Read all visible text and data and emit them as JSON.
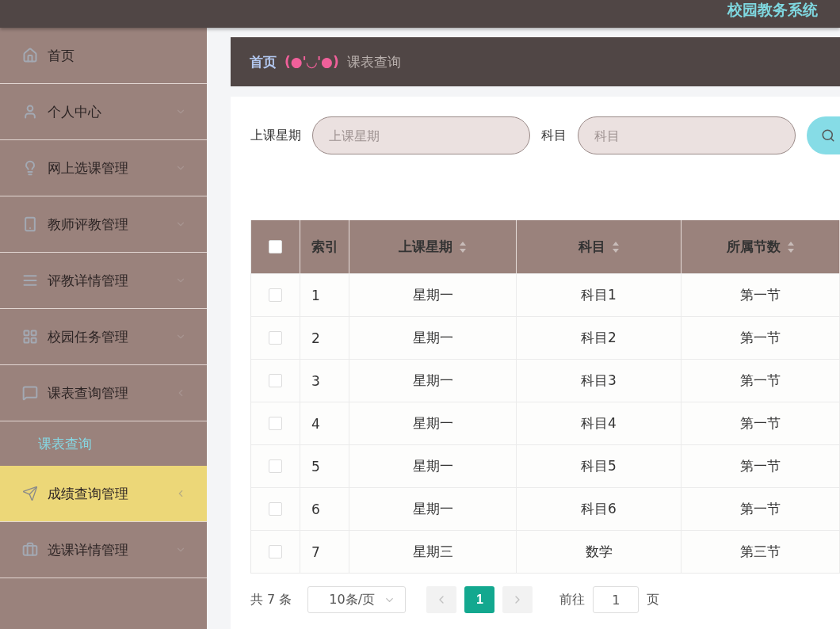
{
  "header": {
    "title": "校园教务系统"
  },
  "sidebar": {
    "items": [
      {
        "label": "首页",
        "selected": false,
        "has_arrow": false
      },
      {
        "label": "个人中心",
        "expanded": false,
        "selected": false,
        "has_arrow": true
      },
      {
        "label": "网上选课管理",
        "expanded": false,
        "selected": false,
        "has_arrow": true
      },
      {
        "label": "教师评教管理",
        "expanded": false,
        "selected": false,
        "has_arrow": true
      },
      {
        "label": "评教详情管理",
        "expanded": false,
        "selected": false,
        "has_arrow": true
      },
      {
        "label": "校园任务管理",
        "expanded": false,
        "selected": false,
        "has_arrow": true
      },
      {
        "label": "课表查询管理",
        "expanded": true,
        "selected": false,
        "has_arrow": true,
        "children": [
          {
            "label": "课表查询",
            "selected": true
          }
        ]
      },
      {
        "label": "成绩查询管理",
        "expanded": false,
        "selected": true,
        "has_arrow": true
      },
      {
        "label": "选课详情管理",
        "expanded": false,
        "selected": false,
        "has_arrow": true
      }
    ]
  },
  "breadcrumb": {
    "home": "首页",
    "separator": "(●'◡'●)",
    "current": "课表查询"
  },
  "search": {
    "fields": [
      {
        "label": "上课星期",
        "placeholder": "上课星期"
      },
      {
        "label": "科目",
        "placeholder": "科目"
      }
    ]
  },
  "table": {
    "select_all": {
      "checked": false
    },
    "columns": [
      {
        "label": "索引",
        "sortable": false
      },
      {
        "label": "上课星期",
        "sortable": true
      },
      {
        "label": "科目",
        "sortable": true
      },
      {
        "label": "所属节数",
        "sortable": true
      }
    ],
    "rows": [
      {
        "checked": false,
        "cells": [
          "1",
          "星期一",
          "科目1",
          "第一节"
        ]
      },
      {
        "checked": false,
        "cells": [
          "2",
          "星期一",
          "科目2",
          "第一节"
        ]
      },
      {
        "checked": false,
        "cells": [
          "3",
          "星期一",
          "科目3",
          "第一节"
        ]
      },
      {
        "checked": false,
        "cells": [
          "4",
          "星期一",
          "科目4",
          "第一节"
        ]
      },
      {
        "checked": false,
        "cells": [
          "5",
          "星期一",
          "科目5",
          "第一节"
        ]
      },
      {
        "checked": false,
        "cells": [
          "6",
          "星期一",
          "科目6",
          "第一节"
        ]
      },
      {
        "checked": false,
        "cells": [
          "7",
          "星期三",
          "数学",
          "第三节"
        ]
      }
    ]
  },
  "pagination": {
    "total": "共 7 条",
    "page_size": "10条/页",
    "pages": [
      {
        "label": "1",
        "selected": true
      }
    ],
    "goto_label": "前往",
    "goto_value": "1",
    "goto_suffix": "页"
  }
}
